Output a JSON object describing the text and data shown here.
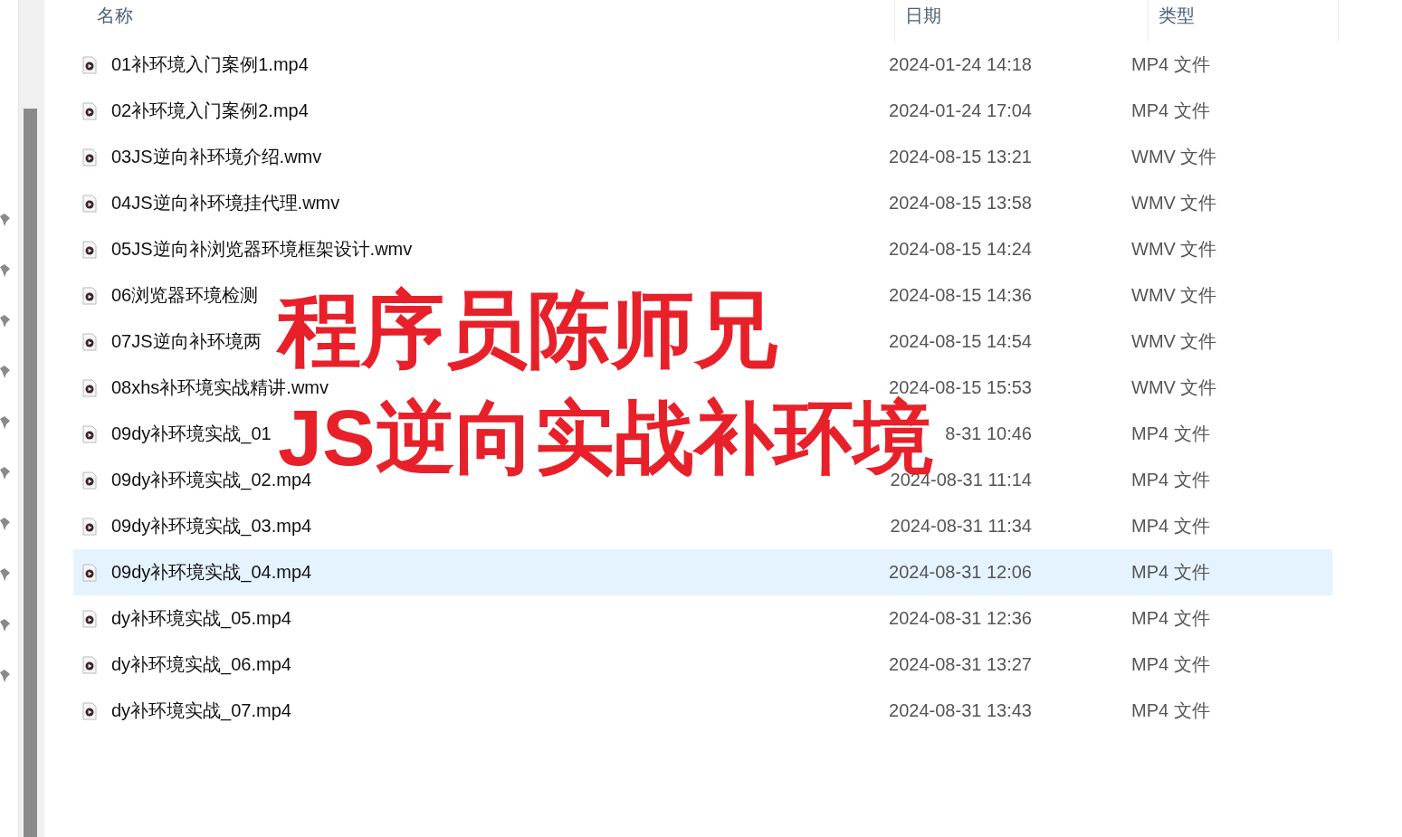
{
  "columns": [
    {
      "label": "名称"
    },
    {
      "label": "日期"
    },
    {
      "label": "类型"
    }
  ],
  "files": [
    {
      "name": "01补环境入门案例1.mp4",
      "date": "2024-01-24 14:18",
      "type": "MP4 文件",
      "selected": false
    },
    {
      "name": "02补环境入门案例2.mp4",
      "date": "2024-01-24 17:04",
      "type": "MP4 文件",
      "selected": false
    },
    {
      "name": "03JS逆向补环境介绍.wmv",
      "date": "2024-08-15 13:21",
      "type": "WMV 文件",
      "selected": false
    },
    {
      "name": "04JS逆向补环境挂代理.wmv",
      "date": "2024-08-15 13:58",
      "type": "WMV 文件",
      "selected": false
    },
    {
      "name": "05JS逆向补浏览器环境框架设计.wmv",
      "date": "2024-08-15 14:24",
      "type": "WMV 文件",
      "selected": false
    },
    {
      "name": "06浏览器环境检测",
      "date": "2024-08-15 14:36",
      "type": "WMV 文件",
      "selected": false
    },
    {
      "name": "07JS逆向补环境两",
      "date": "2024-08-15 14:54",
      "type": "WMV 文件",
      "selected": false
    },
    {
      "name": "08xhs补环境实战精讲.wmv",
      "date": "2024-08-15 15:53",
      "type": "WMV 文件",
      "selected": false
    },
    {
      "name": "09dy补环境实战_01",
      "date": "8-31 10:46",
      "type": "MP4 文件",
      "selected": false
    },
    {
      "name": "09dy补环境实战_02.mp4",
      "date": "2024-08-31 11:14",
      "type": "MP4 文件",
      "selected": false
    },
    {
      "name": "09dy补环境实战_03.mp4",
      "date": "2024-08-31 11:34",
      "type": "MP4 文件",
      "selected": false
    },
    {
      "name": "09dy补环境实战_04.mp4",
      "date": "2024-08-31 12:06",
      "type": "MP4 文件",
      "selected": true
    },
    {
      "name": "dy补环境实战_05.mp4",
      "date": "2024-08-31 12:36",
      "type": "MP4 文件",
      "selected": false
    },
    {
      "name": "dy补环境实战_06.mp4",
      "date": "2024-08-31 13:27",
      "type": "MP4 文件",
      "selected": false
    },
    {
      "name": "dy补环境实战_07.mp4",
      "date": "2024-08-31 13:43",
      "type": "MP4 文件",
      "selected": false
    }
  ],
  "overlay_title": {
    "lines": [
      "程序员陈师兄",
      "JS逆向实战补环境"
    ]
  }
}
